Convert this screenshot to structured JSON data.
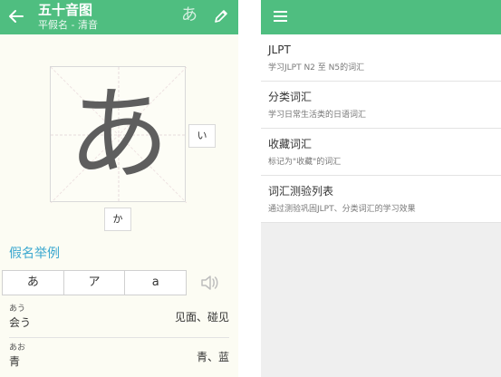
{
  "left": {
    "header": {
      "title": "五十音图",
      "subtitle": "平假名 - 清音",
      "kana_toggle": "あ"
    },
    "stroke_char": "あ",
    "next_right": "い",
    "next_down": "か",
    "section_title": "假名举例",
    "tabs": [
      "あ",
      "ア",
      "a"
    ],
    "examples": [
      {
        "reading": "あう",
        "word": "会う",
        "meaning": "见面、碰见"
      },
      {
        "reading": "あお",
        "word": "青",
        "meaning": "青、蓝"
      }
    ]
  },
  "right": {
    "menu": [
      {
        "title": "JLPT",
        "desc": "学习JLPT N2 至 N5的词汇"
      },
      {
        "title": "分类词汇",
        "desc": "学习日常生活类的日语词汇"
      },
      {
        "title": "收藏词汇",
        "desc": "标记为\"收藏\"的词汇"
      },
      {
        "title": "词汇测验列表",
        "desc": "通过测验巩固JLPT、分类词汇的学习效果"
      }
    ]
  },
  "colors": {
    "accent": "#4fbe80",
    "section_title": "#3aa7cf"
  }
}
